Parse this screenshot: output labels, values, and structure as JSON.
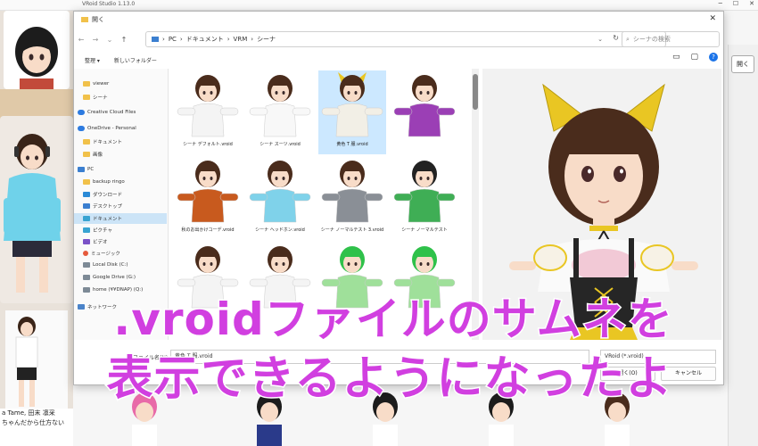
{
  "app": {
    "title": "VRoid Studio 1.13.0"
  },
  "background": {
    "open_button": "開く",
    "chat_lines": [
      "a Tame, 田末 凛采",
      "ちゃんだから仕方ない"
    ]
  },
  "dialog": {
    "title": "開く",
    "breadcrumb": [
      "PC",
      "ドキュメント",
      "VRM",
      "シーナ"
    ],
    "search_placeholder": "シーナの検索",
    "toolbar": {
      "organize": "整理 ▾",
      "new_folder": "新しいフォルダー"
    },
    "sidebar": [
      {
        "label": "viewer",
        "icon": "folder-icon"
      },
      {
        "label": "シーナ",
        "icon": "folder-icon"
      },
      {
        "label": "Creative Cloud Files",
        "icon": "cloud-icon"
      },
      {
        "label": "OneDrive - Personal",
        "icon": "cloud-icon"
      },
      {
        "label": "ドキュメント",
        "icon": "folder-icon"
      },
      {
        "label": "画像",
        "icon": "folder-icon"
      },
      {
        "label": "PC",
        "icon": "pc-icon"
      },
      {
        "label": "backup ringo",
        "icon": "folder-icon"
      },
      {
        "label": "ダウンロード",
        "icon": "download-icon"
      },
      {
        "label": "デスクトップ",
        "icon": "desktop-icon"
      },
      {
        "label": "ドキュメント",
        "icon": "document-icon"
      },
      {
        "label": "ピクチャ",
        "icon": "picture-icon"
      },
      {
        "label": "ビデオ",
        "icon": "video-icon"
      },
      {
        "label": "ミュージック",
        "icon": "music-icon"
      },
      {
        "label": "Local Disk (C:)",
        "icon": "drive-icon"
      },
      {
        "label": "Google Drive (G:)",
        "icon": "drive-icon"
      },
      {
        "label": "home (¥¥DNAP) (Q:)",
        "icon": "drive-icon"
      },
      {
        "label": "ネットワーク",
        "icon": "network-icon"
      }
    ],
    "files": [
      {
        "label": "シーナ デフォルト.vroid",
        "shirt": "#f4f4f4",
        "hair": "#4a2c1c"
      },
      {
        "label": "シーナ スーツ.vroid",
        "shirt": "#f8f8f8",
        "hair": "#4a2c1c"
      },
      {
        "label": "黄色 T 服.vroid",
        "shirt": "#f2efe6",
        "hair": "#4a2c1c"
      },
      {
        "label": "",
        "shirt": "#9b3fb5",
        "hair": "#4a2c1c"
      },
      {
        "label": "秋のお出かけコーデ.vroid",
        "shirt": "#c85a1e",
        "hair": "#4a2c1c"
      },
      {
        "label": "シーナ ヘッドホン.vroid",
        "shirt": "#7fd2ea",
        "hair": "#4a2c1c"
      },
      {
        "label": "シーナ ノーマルテスト 3.vroid",
        "shirt": "#8a8f96",
        "hair": "#4a2c1c"
      },
      {
        "label": "シーナ ノーマルテスト",
        "shirt": "#3fae55",
        "hair": "#222222"
      },
      {
        "label": "",
        "shirt": "#f4f4f4",
        "hair": "#4a2c1c"
      },
      {
        "label": "",
        "shirt": "#f4f4f4",
        "hair": "#4a2c1c"
      },
      {
        "label": "",
        "shirt": "#9fe09a",
        "hair": "#2fc14a"
      },
      {
        "label": "",
        "shirt": "#9fe09a",
        "hair": "#2fc14a"
      }
    ],
    "filename_label": "ファイル名(N):",
    "filename_value": "黄色 T 服.vroid",
    "filetype": "VRoid (*.vroid)",
    "open_label": "開く(O)",
    "cancel_label": "キャンセル"
  },
  "caption": {
    "line1": ".vroidファイルのサムネを",
    "line2": "表示できるようになったよ"
  },
  "colors": {
    "caption": "#d13fe0",
    "selection": "#cce8ff",
    "accent": "#1a73e8"
  }
}
